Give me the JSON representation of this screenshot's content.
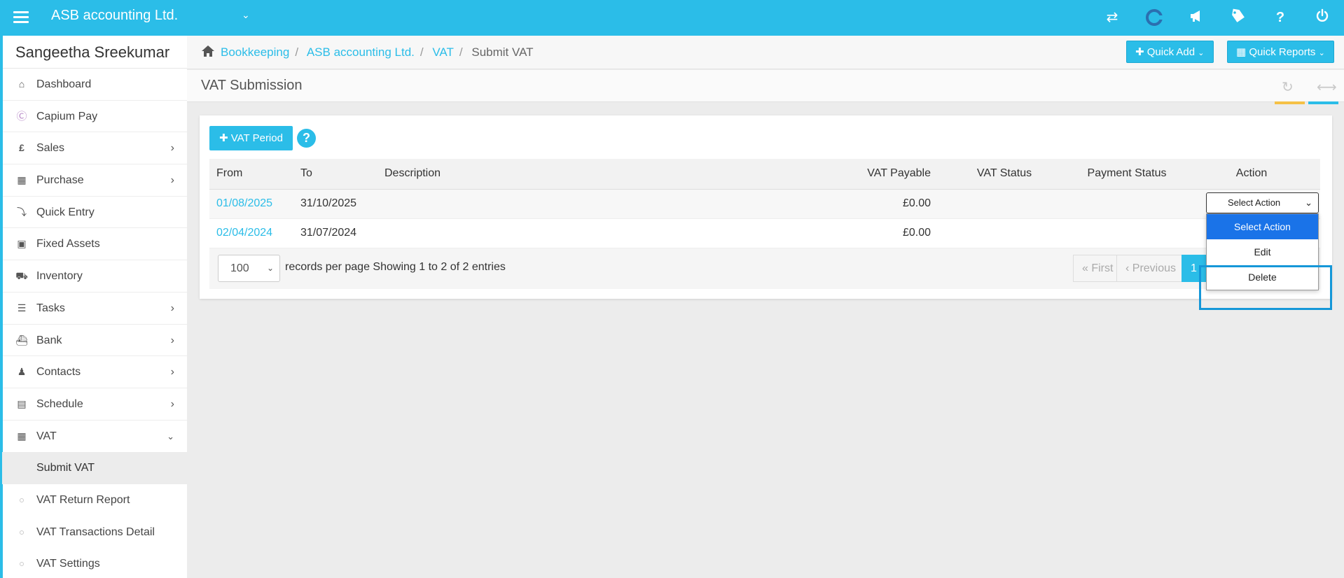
{
  "topbar": {
    "company": "ASB accounting Ltd.",
    "icons": [
      "transfer-icon",
      "capium-logo-icon",
      "megaphone-icon",
      "tag-icon",
      "help-icon",
      "power-icon"
    ]
  },
  "sidebar": {
    "user": "Sangeetha Sreekumar",
    "items": [
      {
        "label": "Dashboard",
        "icon": "home-icon"
      },
      {
        "label": "Capium Pay",
        "icon": "capium-pay-icon"
      },
      {
        "label": "Sales",
        "icon": "pound-icon"
      },
      {
        "label": "Purchase",
        "icon": "grid-icon"
      },
      {
        "label": "Quick Entry",
        "icon": "bolt-icon"
      },
      {
        "label": "Fixed Assets",
        "icon": "building-icon"
      },
      {
        "label": "Inventory",
        "icon": "truck-icon"
      },
      {
        "label": "Tasks",
        "icon": "tasks-icon"
      },
      {
        "label": "Bank",
        "icon": "bank-icon"
      },
      {
        "label": "Contacts",
        "icon": "users-icon"
      },
      {
        "label": "Schedule",
        "icon": "calendar-icon"
      },
      {
        "label": "VAT",
        "icon": "calculator-icon"
      }
    ],
    "subitems": [
      {
        "label": "Submit VAT"
      },
      {
        "label": "VAT Return Report"
      },
      {
        "label": "VAT Transactions Detail"
      },
      {
        "label": "VAT Settings"
      }
    ]
  },
  "breadcrumb": {
    "items": [
      "Bookkeeping",
      "ASB accounting Ltd.",
      "VAT"
    ],
    "current": "Submit VAT"
  },
  "quick": {
    "add": "Quick Add",
    "reports": "Quick Reports"
  },
  "page": {
    "title": "VAT Submission",
    "vat_period_button": "VAT Period",
    "help": "?"
  },
  "table": {
    "headers": {
      "from": "From",
      "to": "To",
      "description": "Description",
      "vat_payable": "VAT Payable",
      "vat_status": "VAT Status",
      "payment_status": "Payment Status",
      "action": "Action"
    },
    "rows": [
      {
        "from": "01/08/2025",
        "to": "31/10/2025",
        "description": "",
        "vat_payable": "£0.00",
        "vat_status": "",
        "payment_status": ""
      },
      {
        "from": "02/04/2024",
        "to": "31/07/2024",
        "description": "",
        "vat_payable": "£0.00",
        "vat_status": "",
        "payment_status": ""
      }
    ]
  },
  "footer": {
    "per_page": "100",
    "per_page_label": "records per page",
    "showing": "Showing 1 to 2 of 2 entries",
    "first": "« First",
    "previous": "‹ Previous",
    "current_page": "1"
  },
  "action_select": {
    "selected": "Select Action",
    "options": [
      "Select Action",
      "Edit",
      "Delete"
    ]
  },
  "colors": {
    "accent": "#2bbde8",
    "option_selected": "#1a73e8",
    "refresh_bar": "#f5c146",
    "expand_bar": "#2bbde8"
  }
}
